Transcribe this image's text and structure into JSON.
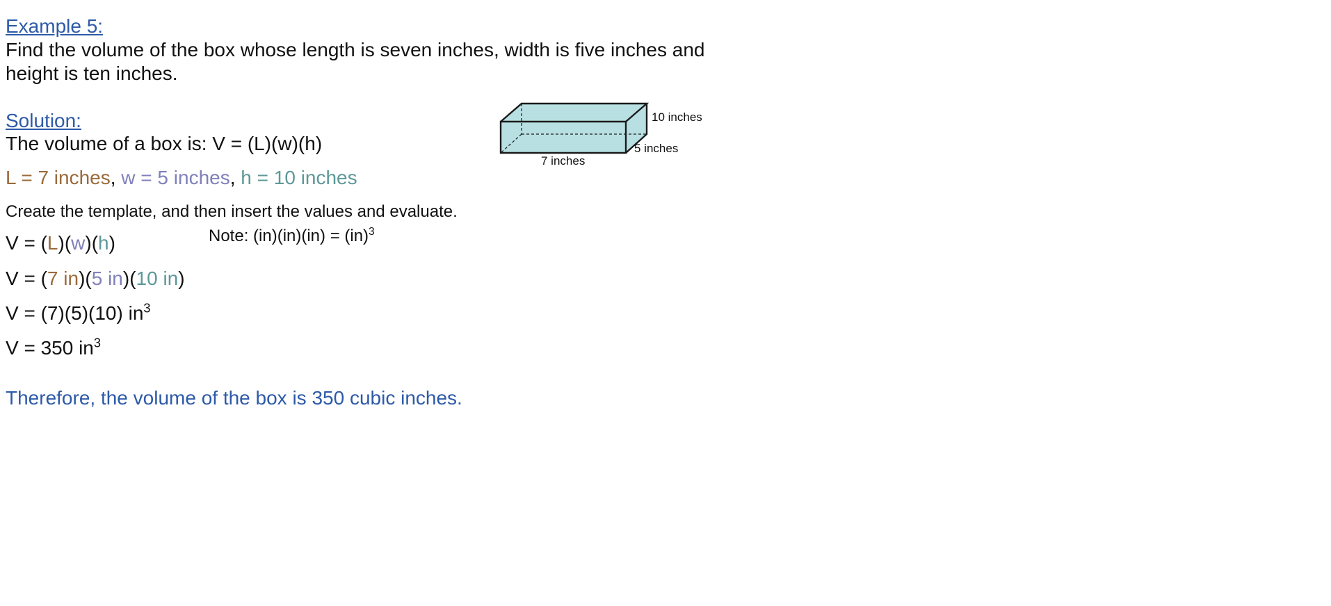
{
  "example": {
    "heading": "Example 5:",
    "problem_line1": "Find the volume of the box whose length is seven inches, width is five inches and",
    "problem_line2": "height is ten inches."
  },
  "solution": {
    "heading": "Solution:",
    "formula_line": "The volume of a box is:  V = (L)(w)(h)",
    "values": {
      "l": "L = 7 inches",
      "sep1": ", ",
      "w": "w = 5 inches",
      "sep2": ", ",
      "h": "h = 10 inches"
    },
    "instruction": "Create the template, and then insert the values and evaluate.",
    "step1": {
      "prefix": "V = (",
      "l": "L",
      "mid1": ")(",
      "w": "w",
      "mid2": ")(",
      "h": "h",
      "suffix": ")"
    },
    "note": {
      "text": "Note:  (in)(in)(in) = (in)",
      "exp": "3"
    },
    "step2": {
      "prefix": "V = (",
      "l": "7 in",
      "mid1": ")(",
      "w": "5 in",
      "mid2": ")(",
      "h": "10 in",
      "suffix": ")"
    },
    "step3": {
      "text": "V = (7)(5)(10) in",
      "exp": "3"
    },
    "step4": {
      "text": "V = 350 in",
      "exp": "3"
    },
    "conclusion": "Therefore, the volume of the box is 350 cubic inches."
  },
  "diagram": {
    "height_label": "10 inches",
    "width_label": "5 inches",
    "length_label": "7 inches",
    "fill_color": "#b8e0e2",
    "stroke_color": "#1a1a1a"
  },
  "colors": {
    "heading": "#2d5aa8",
    "length": "#9a6a3a",
    "width": "#8080bb",
    "height": "#5e9898",
    "conclusion": "#2d5aa8"
  }
}
